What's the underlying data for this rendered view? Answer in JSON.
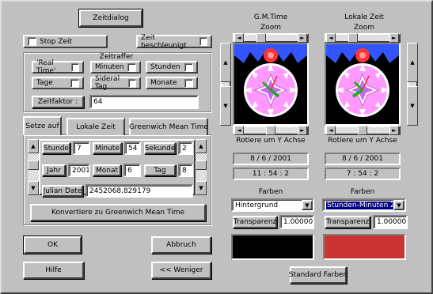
{
  "window": {
    "title_button": "Zeitdialog"
  },
  "controls": {
    "stop_zeit": "Stop Zeit",
    "zeit_beschleunigt": "Zeit beschleunigt"
  },
  "zeitraffer": {
    "group_label": "Zeitraffer",
    "real_time": "'Real Time'",
    "minuten": "Minuten",
    "stunden": "Stunden",
    "tage": "Tage",
    "sideral_tag": "Sideral Tag",
    "monate": "Monate",
    "zeitfaktor_label": "Zeitfaktor :",
    "zeitfaktor_value": "64"
  },
  "tabs": {
    "setze_auf": "Setze auf",
    "lokale_zeit": "Lokale Zeit",
    "gmt": "Greenwich Mean Time"
  },
  "setter": {
    "stunde_label": "Stunde",
    "stunde_value": "7",
    "minute_label": "Minute",
    "minute_value": "54",
    "sekunde_label": "Sekunde",
    "sekunde_value": "2",
    "jahr_label": "Jahr",
    "jahr_value": "2001",
    "monat_label": "Monat",
    "monat_value": "6",
    "tag_label": "Tag",
    "tag_value": "8",
    "julian_label": "Julian Date",
    "julian_value": "2452068.829179",
    "convert_button": "Konvertiere zu Greenwich Mean Time"
  },
  "buttons": {
    "ok": "OK",
    "abbruch": "Abbruch",
    "hilfe": "Hilfe",
    "weniger": "<< Weniger",
    "standard_farben": "Standard Farben"
  },
  "left_clock": {
    "title": "G.M.Time",
    "zoom": "Zoom",
    "rotate": "Rotiere um Y Achse",
    "date": "8 / 6 / 2001",
    "time": "11 : 54 : 2",
    "farben_label": "Farben",
    "farben_selected": "Hintergrund",
    "transparenz_label": "Transparenz",
    "transparenz_value": "1.00000",
    "swatch_color": "#000000"
  },
  "right_clock": {
    "title": "Lokale Zeit",
    "zoom": "Zoom",
    "rotate": "Rotiere um Y Achse",
    "date": "8 / 6 / 2001",
    "time": "7 : 54 : 2",
    "farben_label": "Farben",
    "farben_selected": "Stunden-Minuten Zahn",
    "transparenz_label": "Transparenz",
    "transparenz_value": "1.00000",
    "swatch_color": "#cc3333"
  },
  "icons": {
    "up": "▲",
    "down": "▼",
    "left": "◄",
    "right": "►"
  }
}
